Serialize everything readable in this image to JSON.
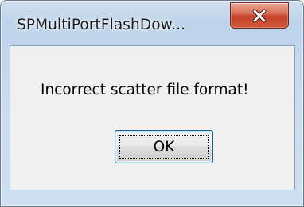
{
  "window": {
    "title": "SPMultiPortFlashDow..."
  },
  "titlebar": {
    "close_icon": "close-x-icon"
  },
  "dialog": {
    "message": "Incorrect scatter file format!",
    "ok_label": "OK"
  },
  "colors": {
    "close_button": "#c5402a",
    "content_background": "#f0f0f0",
    "frame": "#c2d6ec"
  }
}
